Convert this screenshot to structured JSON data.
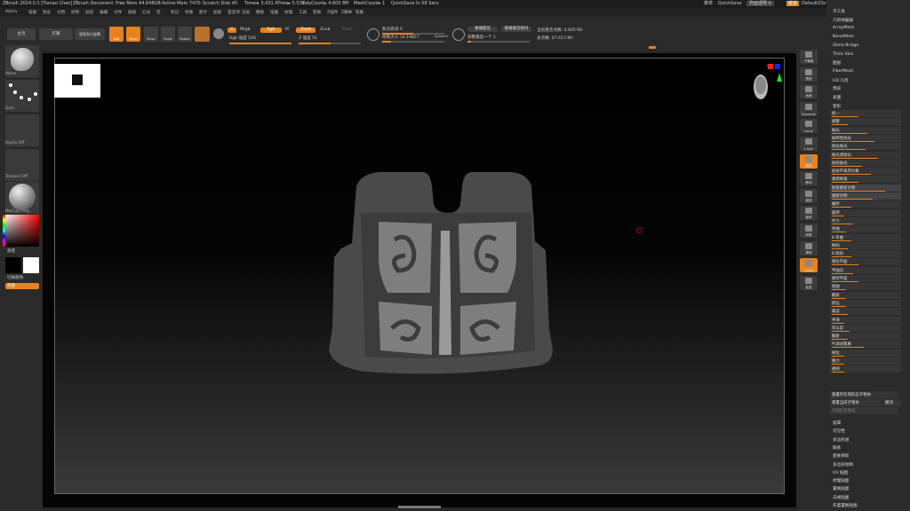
{
  "titlebar": {
    "app": "ZBrush 2024.0.1 [Tianao Chen]",
    "doc": "ZBrush Document",
    "freemem": "Free Mem 44.648GB",
    "activemem": "Active Mem 7470",
    "scratch": "Scratch Disk 45",
    "timer": "Timer▸ 3.431 ATime▸ 5.531",
    "polycount": "PolyCount▸ 4.605 MP",
    "meshcount": "MeshCount▸ 1",
    "quicksave": "QuickSave In 58 Secs",
    "menus_label": "菜单",
    "quicksave_btn": "QuickSave",
    "transparency": "界面透明 0",
    "default_btn": "菜单",
    "script": "DefaultZScript"
  },
  "menubar": [
    "Alpha",
    "笔刷",
    "色彩",
    "文档",
    "绘制",
    "动态",
    "编辑",
    "文件",
    "层级",
    "灯光",
    "宏",
    "标记",
    "材质",
    "影片",
    "拾取",
    "首选项",
    "渲染",
    "模板",
    "笔触",
    "纹理",
    "工具",
    "变换",
    "Z插件",
    "Z脚本",
    "帮助"
  ],
  "toolbar": {
    "lightbox": "主页",
    "lightbox2": "灯箱",
    "spotlight": "便签和引遮罩",
    "edit": "Edit",
    "draw": "Draw",
    "move": "Move",
    "scale": "Scale",
    "rotate": "Rotate",
    "a": "A",
    "mrgb": "Mrgb",
    "rgb": "Rgb",
    "m": "M",
    "zadd": "Zadd",
    "zsub": "Zsub",
    "zcut": "Zcut",
    "rgb_intensity": "Rgb 强度 100",
    "z_intensity": "Z 强度 51",
    "focal_shift": "焦点衰减 0",
    "draw_size": "绘制大小 14.19857",
    "dynamic": "Dynamic",
    "replay_last": "重播最后",
    "replay_last_rel": "重播最后相对",
    "replay_count": "调整最后一个 1",
    "active_points": "当前激活点数: 4.605 Mil",
    "total_points": "总点数: 67.613 Mil"
  },
  "leftshelf": {
    "brush": "Move",
    "stroke": "Dots",
    "alpha": "Alpha Off",
    "texture": "Texture Off",
    "material": "MatCap Gray",
    "gradient": "渐变",
    "switch_color": "切换颜色",
    "alternate": "交替"
  },
  "rightshelf": [
    "子像素",
    "透视",
    "地面",
    "Dynamic",
    "Local",
    "L.Sym",
    "框架",
    "移动",
    "缩放",
    "旋转",
    "线框",
    "透明",
    "Ghost",
    "独显"
  ],
  "palette": {
    "top_items": [
      "子工具",
      "几何体编辑",
      "ArrayMesh",
      "NanoMesh",
      "Slime Bridge",
      "Thick Skin",
      "图层",
      "FiberMesh",
      "HD 几何",
      "预览",
      "表面",
      "变形"
    ],
    "deform_rows": [
      "统一",
      "调整",
      "抛光",
      "按特性抛光",
      "锐化抛光",
      "按光滑锐化",
      "按组抛光",
      "投射不离弃对象",
      "重建网格",
      "智能重新对称",
      "重新对称",
      "偏移",
      "旋转",
      "大小",
      "弯曲",
      "S 弯曲",
      "倾斜",
      "S 倾斜",
      "锥化平面",
      "平面化",
      "球状平面",
      "扭曲",
      "膨胀",
      "挤压",
      "噪波",
      "平滑",
      "可以是",
      "膨胀",
      "气球式膨胀",
      "球化",
      "重力",
      "透视"
    ],
    "bottom_buttons": [
      "重置所有到形态子物体",
      "重置当前子物体",
      "撤消",
      "存储形变数据"
    ],
    "bottom_items": [
      "遮罩",
      "可见性",
      "多边形组",
      "联系",
      "变换目标",
      "多边形绘制",
      "UV 贴图",
      "纹理贴图",
      "置换贴图",
      "法线贴图",
      "矢量置换贴图"
    ]
  },
  "accent": "#e8821e"
}
